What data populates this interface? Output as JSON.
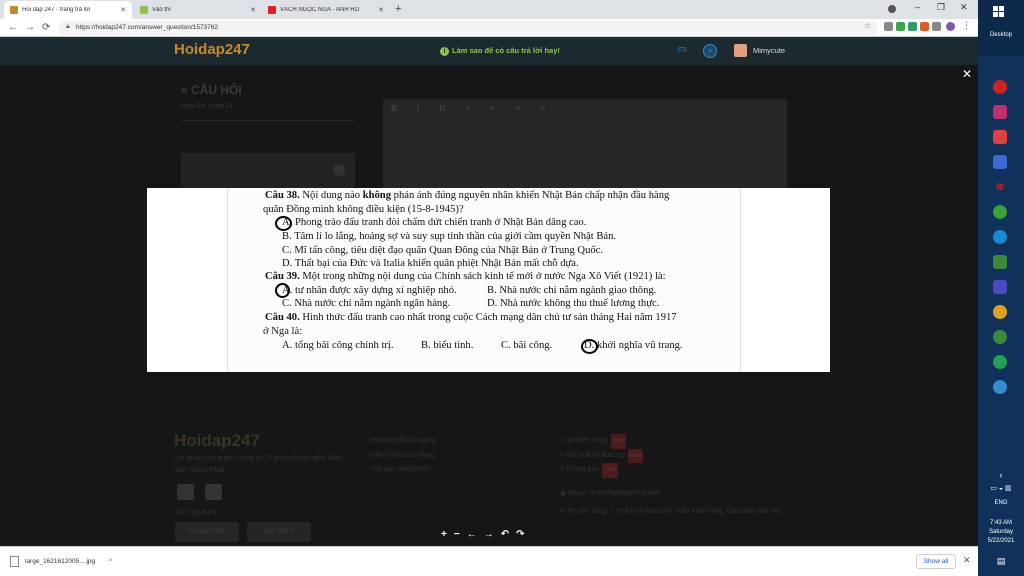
{
  "browser": {
    "tabs": [
      {
        "title": "Hỏi đáp 247 - trang trả lời",
        "active": true,
        "favicon_color": "#c78a2a"
      },
      {
        "title": "Vào thi",
        "active": false,
        "favicon_color": "#8fc44a"
      },
      {
        "title": "VÁCH NGỌC NGÀ - ANH RỒ",
        "active": false,
        "favicon_color": "#e02020"
      }
    ],
    "new_tab": "+",
    "address": "https://hoidap247.com/answer_question/1573762",
    "nav": {
      "back": "←",
      "forward": "→",
      "reload": "⟳"
    },
    "window_controls": {
      "minimize": "–",
      "restore": "❐",
      "close": "✕"
    },
    "extension_colors": [
      "#888",
      "#3aa44a",
      "#2e9b6a",
      "#e05a2a",
      "#888",
      "#7a5ab0"
    ]
  },
  "site": {
    "logo": "Hoidap247",
    "tip": "Làm sao để có câu trả lời hay!",
    "tip_icon": "i",
    "username": "Mimycute",
    "chat_icon": "chat-icon",
    "bell_icon": "bell-icon"
  },
  "page": {
    "section_title": "« CÂU HỎI",
    "subject": "Lịch Sử - Lớp 11",
    "editor_tools": "B I U ≡ ≡ ≡ ≡",
    "panel_dot": "•"
  },
  "footer": {
    "logo": "Hoidap247",
    "description": "Cơ quan chủ quản: Công ty Cổ phần Công nghệ Giáo dục Thành Phát",
    "download_label": "Tải ứng dụng",
    "stores": [
      "Google Play",
      "App Store"
    ],
    "links_col1": [
      "Hướng dẫn sử dụng",
      "Điều khoản sử dụng",
      "Nội quy hoidap247"
    ],
    "links_col2": [
      "Sự kiện nóng",
      "Kết quả thi đua top",
      "Thông báo"
    ],
    "new_badge": "NEW",
    "inbox": "Inbox: m.me/hoidap247online",
    "address": "Trụ sở: Tầng 7, Tòa nhà Intracom, Trần Thái Tông, Cầu Giấy, Hà Nội."
  },
  "viewer": {
    "close": "✕",
    "tools": [
      "+",
      "−",
      "←",
      "→",
      "↶",
      "↷"
    ],
    "lines": {
      "q38_label": "Câu 38.",
      "q38_pre": "Nội dung nào ",
      "q38_bold": "không",
      "q38_post": " phản ánh đúng nguyên nhân khiến Nhật Bản chấp nhận đầu hàng",
      "q38_cont": "quân Đồng minh không điều kiện (15-8-1945)?",
      "q38_a": "A. Phong trào đấu tranh đòi chấm dứt chiến tranh ở Nhật Bản dâng cao.",
      "q38_b": "B. Tâm lí lo lắng, hoảng sợ và suy sụp tinh thần của giới cầm quyền Nhật Bản.",
      "q38_c": "C. Mĩ tấn công, tiêu diệt đạo quân Quan Đông của Nhật Bản ở Trung Quốc.",
      "q38_d": "D. Thất bại của Đức và Italia khiến quân phiệt Nhật Bản mất chỗ dựa.",
      "q39_label": "Câu 39.",
      "q39_text": "Một trong những nội dung của Chính sách kinh tế mới ở nước Nga Xô Viết (1921) là:",
      "q39_a": "A. tư nhân được xây dựng xí nghiệp nhỏ.",
      "q39_b": "B. Nhà nước chỉ nắm ngành giao thông.",
      "q39_c": "C. Nhà nước chỉ nắm ngành ngân hàng.",
      "q39_d": "D. Nhà nước không thu thuế lương thực.",
      "q40_label": "Câu 40.",
      "q40_text": "Hình thức đấu tranh cao nhất trong cuộc Cách mạng dân chủ tư sản tháng Hai năm 1917",
      "q40_cont": "ở Nga là:",
      "q40_a": "A. tổng bãi công chính trị.",
      "q40_b": "B. biểu tình.",
      "q40_c": "C. bãi công.",
      "q40_d": "D. khởi nghĩa vũ trang."
    }
  },
  "downloads": {
    "file": "large_1621612005....jpg",
    "chevron": "^",
    "show_all": "Show all",
    "close": "✕"
  },
  "taskbar": {
    "desktop": "Desktop",
    "chevron": "‹",
    "lang": "ENG",
    "time": "7:43 AM",
    "day": "Saturday",
    "date": "5/22/2021",
    "icon_colors": [
      "#d02020",
      "#c0306a",
      "#e04040",
      "#3a6ad0",
      "#e03030",
      "#3aa03a",
      "#1a8ad0",
      "#3a8a3a",
      "#4a4ac0",
      "#e0a020",
      "#3a8a3a",
      "#20a050",
      "#3a8ad0"
    ]
  }
}
